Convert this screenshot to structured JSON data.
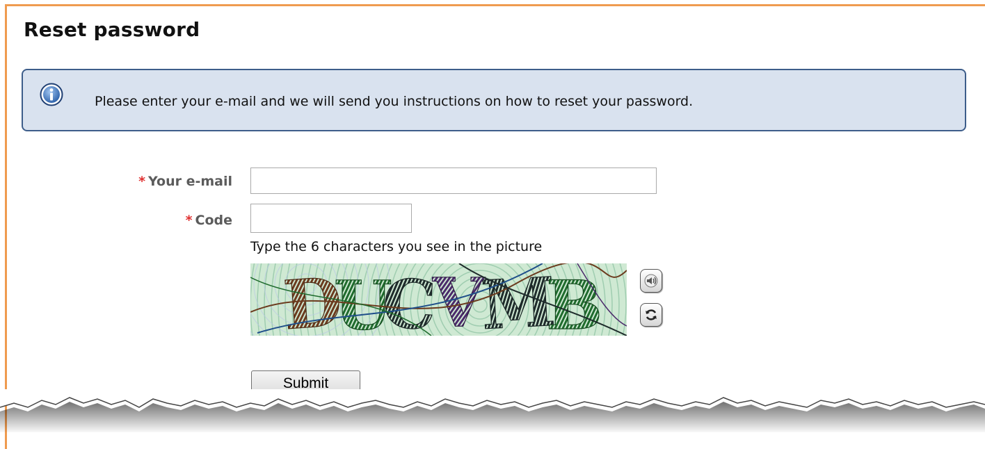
{
  "page": {
    "title": "Reset password"
  },
  "info": {
    "icon": "info-icon",
    "message": "Please enter your e-mail and we will send you instructions on how to reset your password."
  },
  "form": {
    "email": {
      "required_mark": "*",
      "label": "Your e-mail",
      "value": "",
      "placeholder": ""
    },
    "code": {
      "required_mark": "*",
      "label": "Code",
      "value": "",
      "placeholder": ""
    },
    "captcha": {
      "hint": "Type the 6 characters you see in the picture",
      "text": "DUCVMB",
      "audio_icon": "speaker-icon",
      "refresh_icon": "refresh-icon"
    },
    "submit_label": "Submit"
  },
  "colors": {
    "frame": "#ef9b4f",
    "info_bg": "#d9e2ef",
    "info_border": "#3d5d8a",
    "required": "#e03131",
    "label": "#5b5b5b"
  }
}
